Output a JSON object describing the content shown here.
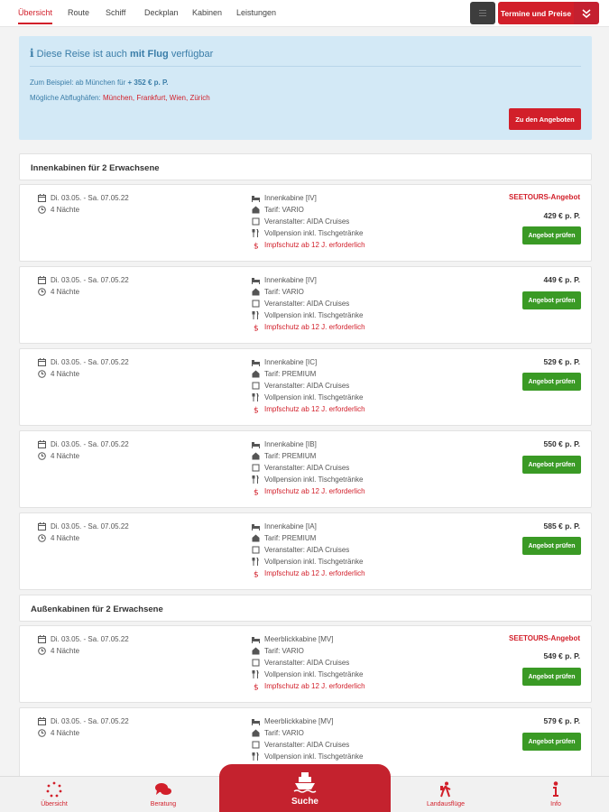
{
  "nav": {
    "tabs": [
      {
        "label": "Übersicht",
        "active": true
      },
      {
        "label": "Route"
      },
      {
        "label": "Schiff"
      },
      {
        "label": "Deckplan"
      },
      {
        "label": "Kabinen"
      },
      {
        "label": "Leistungen"
      }
    ],
    "cta_label": "Termine und Preise"
  },
  "flight": {
    "title_prefix": "Diese Reise ist auch",
    "title_bold": "mit Flug",
    "title_suffix": "verfügbar",
    "example_prefix": "Zum Beispiel: ab München für",
    "example_price": "+ 352 € p. P.",
    "airports_label": "Mögliche Abflughäfen:",
    "airports": "München, Frankfurt, Wien, Zürich",
    "button_label": "Zu den Angeboten"
  },
  "sections": [
    {
      "title": "Innenkabinen für 2 Erwachsene",
      "offers": [
        {
          "date": "Di. 03.05. - Sa. 07.05.22",
          "nights": "4 Nächte",
          "cabin": "Innenkabine [IV]",
          "tariff": "Tarif: VARIO",
          "operator": "Veranstalter: AIDA Cruises",
          "board": "Vollpension inkl. Tischgetränke",
          "notice": "Impfschutz ab 12 J. erforderlich",
          "special": "SEETOURS-Angebot",
          "price": "429 € p. P.",
          "button": "Angebot prüfen"
        },
        {
          "date": "Di. 03.05. - Sa. 07.05.22",
          "nights": "4 Nächte",
          "cabin": "Innenkabine [IV]",
          "tariff": "Tarif: VARIO",
          "operator": "Veranstalter: AIDA Cruises",
          "board": "Vollpension inkl. Tischgetränke",
          "notice": "Impfschutz ab 12 J. erforderlich",
          "price": "449 € p. P.",
          "button": "Angebot prüfen"
        },
        {
          "date": "Di. 03.05. - Sa. 07.05.22",
          "nights": "4 Nächte",
          "cabin": "Innenkabine [IC]",
          "tariff": "Tarif: PREMIUM",
          "operator": "Veranstalter: AIDA Cruises",
          "board": "Vollpension inkl. Tischgetränke",
          "notice": "Impfschutz ab 12 J. erforderlich",
          "price": "529 € p. P.",
          "button": "Angebot prüfen"
        },
        {
          "date": "Di. 03.05. - Sa. 07.05.22",
          "nights": "4 Nächte",
          "cabin": "Innenkabine [IB]",
          "tariff": "Tarif: PREMIUM",
          "operator": "Veranstalter: AIDA Cruises",
          "board": "Vollpension inkl. Tischgetränke",
          "notice": "Impfschutz ab 12 J. erforderlich",
          "price": "550 € p. P.",
          "button": "Angebot prüfen"
        },
        {
          "date": "Di. 03.05. - Sa. 07.05.22",
          "nights": "4 Nächte",
          "cabin": "Innenkabine [IA]",
          "tariff": "Tarif: PREMIUM",
          "operator": "Veranstalter: AIDA Cruises",
          "board": "Vollpension inkl. Tischgetränke",
          "notice": "Impfschutz ab 12 J. erforderlich",
          "price": "585 € p. P.",
          "button": "Angebot prüfen"
        }
      ]
    },
    {
      "title": "Außenkabinen für 2 Erwachsene",
      "offers": [
        {
          "date": "Di. 03.05. - Sa. 07.05.22",
          "nights": "4 Nächte",
          "cabin": "Meerblickkabine [MV]",
          "tariff": "Tarif: VARIO",
          "operator": "Veranstalter: AIDA Cruises",
          "board": "Vollpension inkl. Tischgetränke",
          "notice": "Impfschutz ab 12 J. erforderlich",
          "special": "SEETOURS-Angebot",
          "price": "549 € p. P.",
          "button": "Angebot prüfen"
        },
        {
          "date": "Di. 03.05. - Sa. 07.05.22",
          "nights": "4 Nächte",
          "cabin": "Meerblickkabine [MV]",
          "tariff": "Tarif: VARIO",
          "operator": "Veranstalter: AIDA Cruises",
          "board": "Vollpension inkl. Tischgetränke",
          "price": "579 € p. P.",
          "button": "Angebot prüfen"
        }
      ]
    }
  ],
  "bottom_nav": [
    {
      "label": "Übersicht",
      "icon": "dots-circle-icon"
    },
    {
      "label": "Beratung",
      "icon": "chat-bubbles-icon"
    },
    {
      "label": "Suche",
      "icon": "ship-icon",
      "highlight": true
    },
    {
      "label": "Landausflüge",
      "icon": "hiker-icon"
    },
    {
      "label": "Info",
      "icon": "info-icon"
    }
  ],
  "colors": {
    "brand_red": "#d21f2a",
    "success_green": "#3a9a25",
    "info_blue": "#3a7da8",
    "info_bg": "#d3e9f6"
  }
}
